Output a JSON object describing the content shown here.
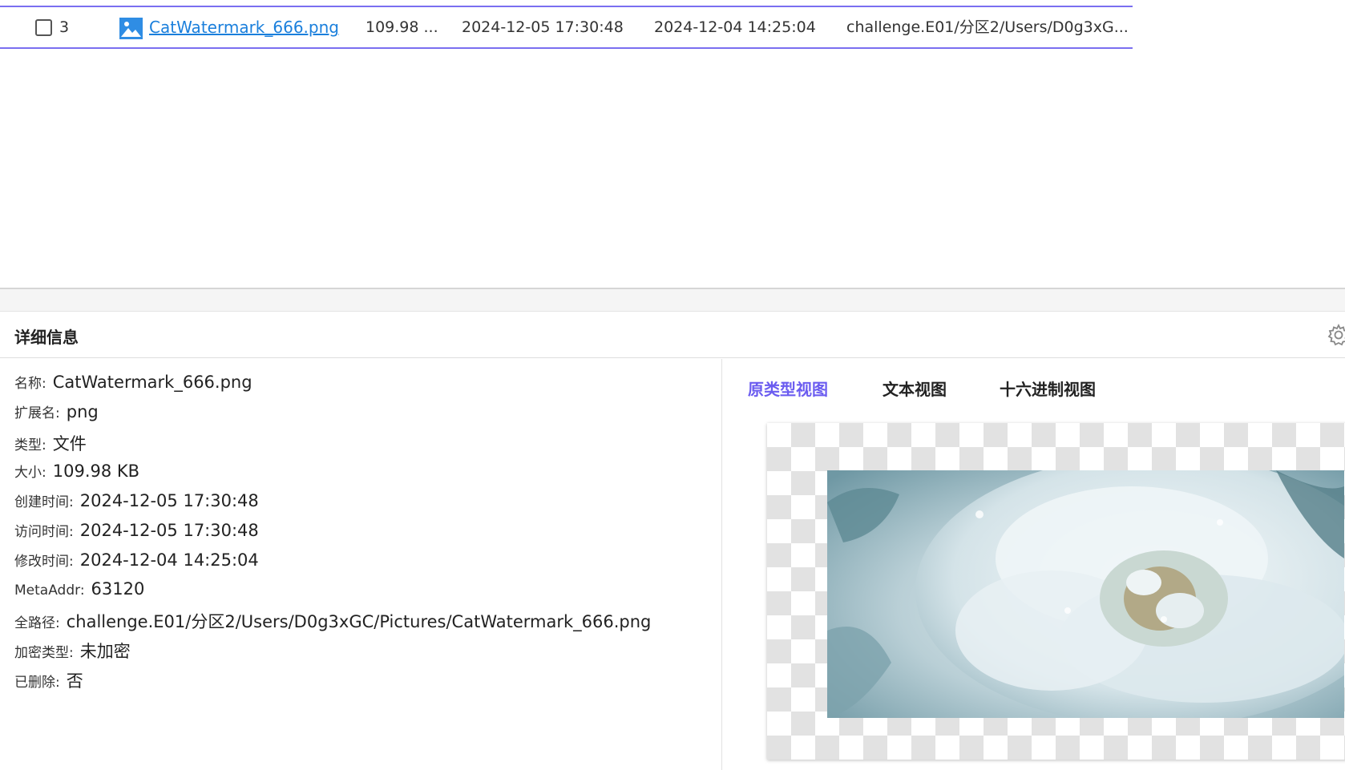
{
  "table": {
    "row": {
      "index": "3",
      "name": "CatWatermark_666.png",
      "size": "109.98 ...",
      "created": "2024-12-05 17:30:48",
      "modified": "2024-12-04 14:25:04",
      "path": "challenge.E01/分区2/Users/D0g3xG..."
    }
  },
  "details": {
    "title": "详细信息",
    "fields": [
      {
        "key": "名称:",
        "value": "CatWatermark_666.png"
      },
      {
        "key": "扩展名:",
        "value": "png"
      },
      {
        "key": "类型:",
        "value": "文件"
      },
      {
        "key": "大小:",
        "value": "109.98 KB"
      },
      {
        "key": "创建时间:",
        "value": "2024-12-05 17:30:48"
      },
      {
        "key": "访问时间:",
        "value": "2024-12-05 17:30:48"
      },
      {
        "key": "修改时间:",
        "value": "2024-12-04 14:25:04"
      },
      {
        "key": "MetaAddr:",
        "value": "63120"
      },
      {
        "key": "全路径:",
        "value": "challenge.E01/分区2/Users/D0g3xGC/Pictures/CatWatermark_666.png"
      },
      {
        "key": "加密类型:",
        "value": "未加密"
      },
      {
        "key": "已删除:",
        "value": "否"
      }
    ]
  },
  "preview": {
    "tabs": [
      {
        "label": "原类型视图",
        "active": true
      },
      {
        "label": "文本视图",
        "active": false
      },
      {
        "label": "十六进制视图",
        "active": false
      }
    ]
  },
  "icons": {
    "file_type": "image-file-icon",
    "settings": "gear-icon",
    "checkbox": "checkbox-icon"
  },
  "colors": {
    "accent": "#6b5cf0",
    "link": "#1a7fdc",
    "selection_border": "#7a6ff0"
  }
}
